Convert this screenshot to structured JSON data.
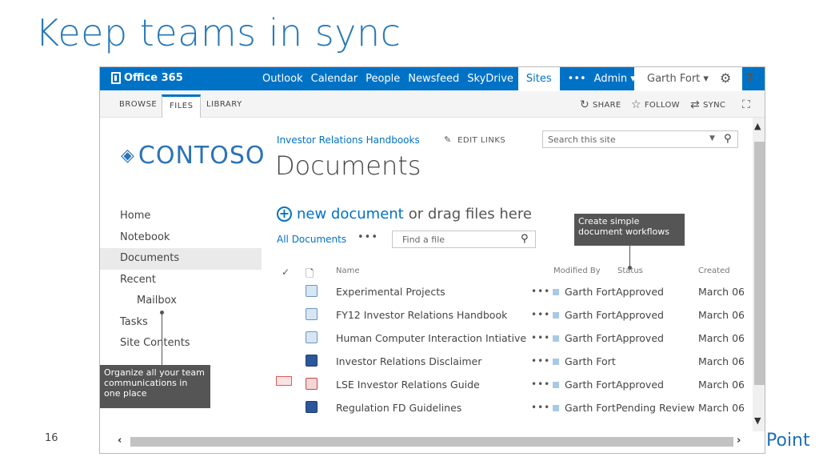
{
  "slide": {
    "title": "Keep teams in sync",
    "page_number": "16",
    "brand_fragment": "Point"
  },
  "suite_bar": {
    "logo_text": "Office 365",
    "nav": [
      "Outlook",
      "Calendar",
      "People",
      "Newsfeed",
      "SkyDrive",
      "Sites",
      "•••",
      "Admin ▾"
    ],
    "active_nav": "Sites",
    "user_name": "Garth Fort ▾",
    "help": "?",
    "bg_color": "#0072c6"
  },
  "ribbon": {
    "tabs": [
      "BROWSE",
      "FILES",
      "LIBRARY"
    ],
    "selected_tab": "FILES",
    "share": "SHARE",
    "follow": "FOLLOW",
    "sync": "SYNC"
  },
  "site": {
    "logo_text": "CONTOSO",
    "breadcrumb": "Investor Relations Handbooks",
    "edit_links": "EDIT LINKS",
    "page_title": "Documents",
    "search_placeholder": "Search this site"
  },
  "left_nav": [
    {
      "label": "Home"
    },
    {
      "label": "Notebook"
    },
    {
      "label": "Documents",
      "selected": true
    },
    {
      "label": "Recent"
    },
    {
      "label": "Mailbox",
      "sub": true
    },
    {
      "label": "Tasks"
    },
    {
      "label": "Site Contents"
    }
  ],
  "library": {
    "new_label": "new document",
    "drag_label": "or drag files here",
    "view_label": "All Documents",
    "view_more": "•••",
    "find_placeholder": "Find a file",
    "columns": {
      "name": "Name",
      "modified_by": "Modified By",
      "status": "Status",
      "created": "Created"
    },
    "rows": [
      {
        "name": "Experimental Projects",
        "icon": "publisher-file-icon",
        "modified_by": "Garth Fort",
        "status": "Approved",
        "created": "March 06"
      },
      {
        "name": "FY12 Investor Relations Handbook",
        "icon": "publisher-file-icon",
        "modified_by": "Garth Fort",
        "status": "Approved",
        "created": "March 06"
      },
      {
        "name": "Human Computer Interaction Intiative",
        "icon": "publisher-file-icon",
        "modified_by": "Garth Fort",
        "status": "Approved",
        "created": "March 06"
      },
      {
        "name": "Investor Relations Disclaimer",
        "icon": "word-file-icon",
        "modified_by": "Garth Fort",
        "status": "",
        "created": "March 06"
      },
      {
        "name": "LSE Investor Relations Guide",
        "icon": "pdf-file-icon",
        "modified_by": "Garth Fort",
        "status": "Approved",
        "created": "March 06"
      },
      {
        "name": "Regulation FD Guidelines",
        "icon": "word-file-icon",
        "modified_by": "Garth Fort",
        "status": "Pending Review",
        "created": "March 06"
      }
    ]
  },
  "callouts": {
    "workflow": "Create simple document workflows",
    "communications": "Organize all your team communications in one place"
  }
}
